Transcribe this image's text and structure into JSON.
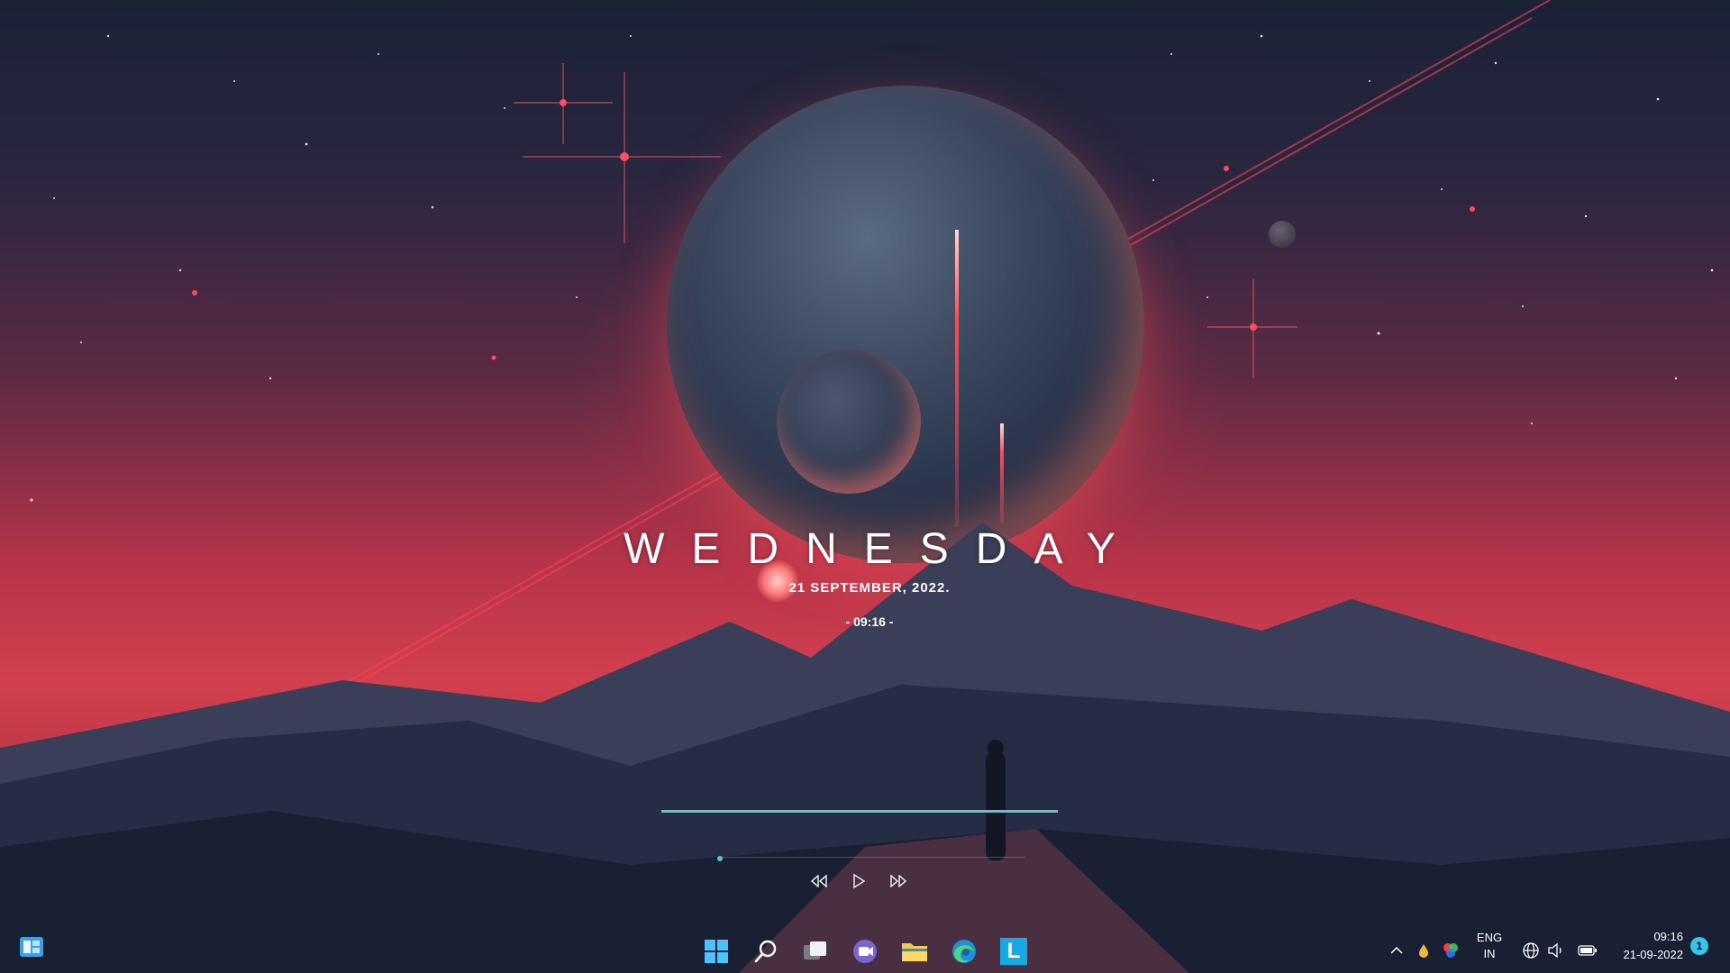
{
  "widget": {
    "day": "WEDNESDAY",
    "date": "21 SEPTEMBER, 2022.",
    "time": "- 09:16 -"
  },
  "media": {
    "accent_color": "#5bc6d0",
    "buttons": [
      "rewind-icon",
      "play-icon",
      "fast-forward-icon"
    ]
  },
  "taskbar": {
    "apps": [
      "start",
      "search",
      "task-view",
      "teams-chat",
      "file-explorer",
      "edge",
      "launcher"
    ],
    "launcher_letter": "L"
  },
  "tray": {
    "language_line1": "ENG",
    "language_line2": "IN",
    "time": "09:16",
    "date": "21-09-2022",
    "notification_count": "1"
  }
}
